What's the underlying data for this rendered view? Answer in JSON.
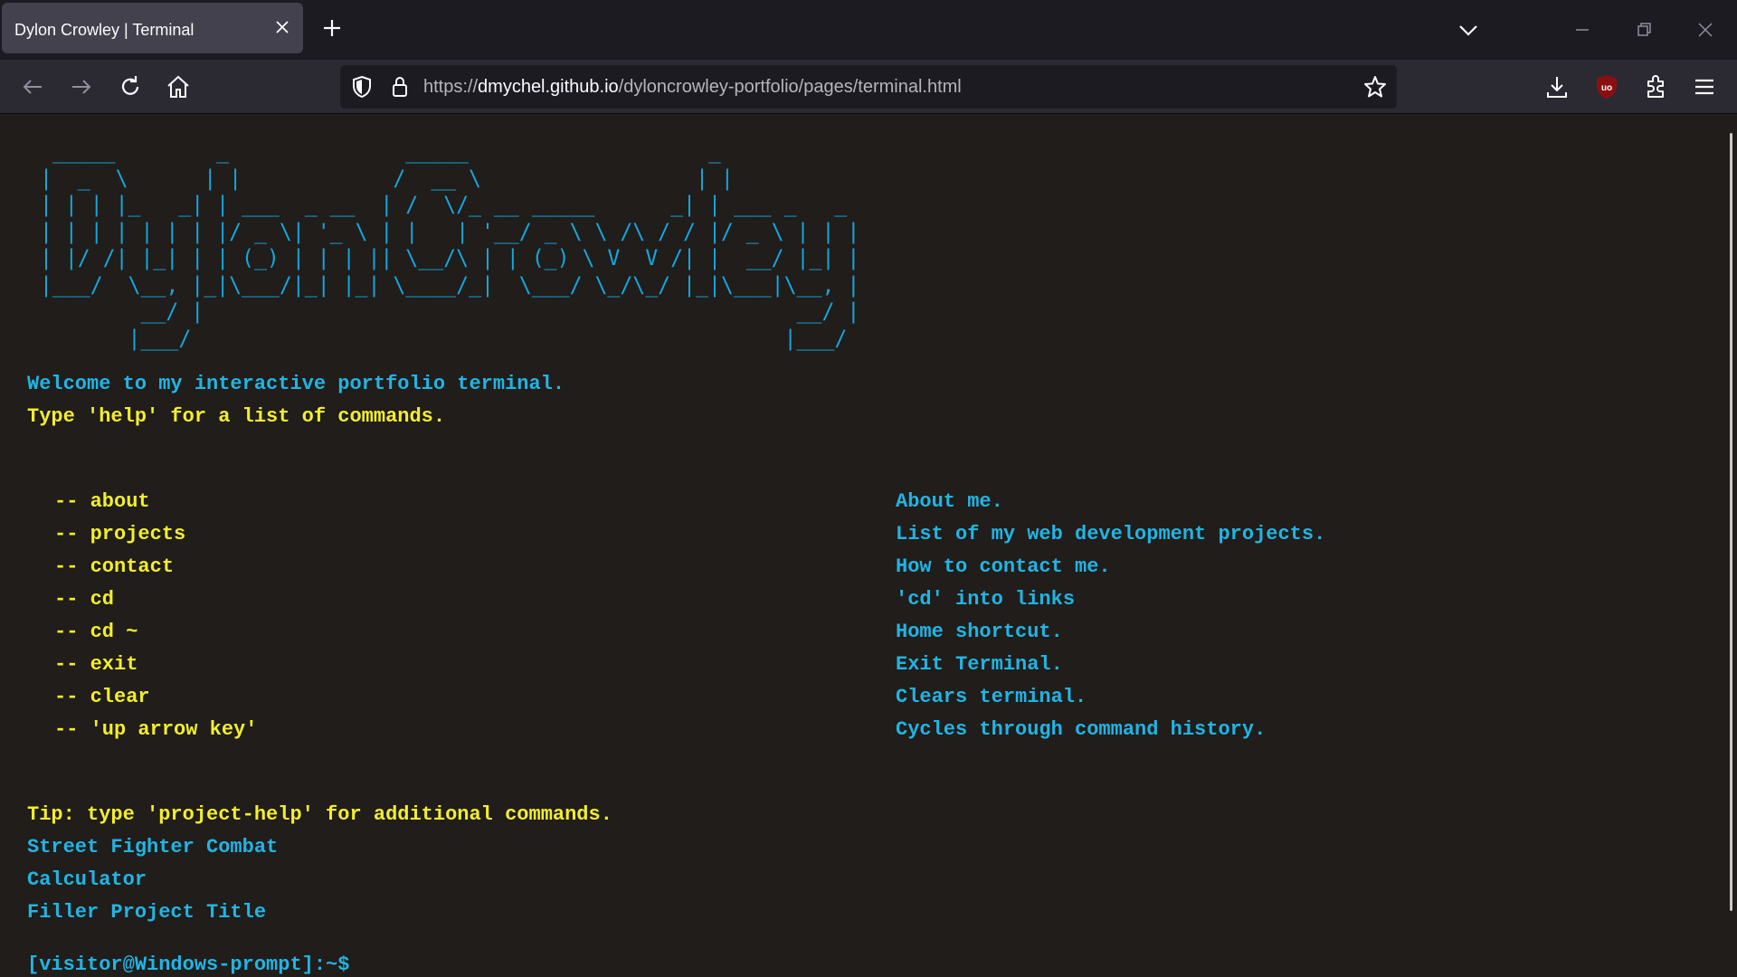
{
  "browser": {
    "tab_title": "Dylon Crowley | Terminal",
    "url_prefix": "https://",
    "url_domain": "dmychel.github.io",
    "url_path": "/dyloncrowley-portfolio/pages/terminal.html"
  },
  "icons": {
    "tab_close": "close-icon",
    "new_tab": "plus-icon",
    "tab_list": "chevron-down-icon",
    "minimize": "minimize-icon",
    "restore": "restore-icon",
    "window_close": "close-icon",
    "back": "arrow-left-icon",
    "forward": "arrow-right-icon",
    "reload": "reload-icon",
    "home": "home-icon",
    "shield": "shield-icon",
    "lock": "lock-icon",
    "bookmark": "star-icon",
    "downloads": "download-icon",
    "ublock": "ublock-icon",
    "extensions": "puzzle-icon",
    "menu": "hamburger-icon"
  },
  "terminal": {
    "ascii_banner": "  _____        _              _____                   _\n |  _  \\      | |            /  __ \\                 | |\n | | | |_   _| | ___  _ __  | /  \\/_ __ _____      _| | ___ _   _\n | | | | | | | |/ _ \\| '_ \\ | |   | '__/ _ \\ \\ /\\ / / |/ _ \\ | | |\n | |/ /| |_| | | (_) | | | || \\__/\\ | | (_) \\ V  V /| |  __/ |_| |\n |___/  \\__, |_|\\___/|_| |_| \\____/_|  \\___/ \\_/\\_/ |_|\\___|\\__, |\n         __/ |                                               __/ |\n        |___/                                               |___/",
    "welcome": "Welcome to my interactive portfolio terminal.",
    "help_hint": "Type 'help' for a list of commands.",
    "commands": [
      {
        "name": "-- about",
        "desc": "About me."
      },
      {
        "name": "-- projects",
        "desc": "List of my web development projects."
      },
      {
        "name": "-- contact",
        "desc": "How to contact me."
      },
      {
        "name": "-- cd",
        "desc": "'cd' into links"
      },
      {
        "name": "-- cd ~",
        "desc": "Home shortcut."
      },
      {
        "name": "-- exit",
        "desc": "Exit Terminal."
      },
      {
        "name": "-- clear",
        "desc": "Clears terminal."
      },
      {
        "name": "-- 'up arrow key'",
        "desc": "Cycles through command history."
      }
    ],
    "tip": "Tip: type 'project-help' for additional commands.",
    "projects": [
      "Street Fighter Combat",
      "Calculator",
      "Filler Project Title"
    ],
    "prompt_partial": "[visitor@Windows-prompt]:~$"
  },
  "colors": {
    "cyan": "#20b5e4",
    "yellow": "#f3ee2b",
    "terminal_bg": "#201d1b"
  }
}
